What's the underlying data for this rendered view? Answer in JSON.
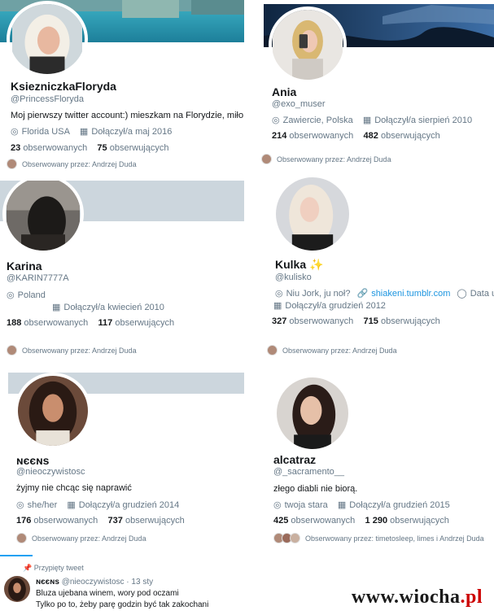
{
  "profiles": [
    {
      "name": "KsiezniczkaFloryda",
      "handle": "@PrincessFloryda",
      "bio": "Moj pierwszy twitter account:) mieszkam na Florydzie, miło mi p",
      "location": "Florida USA",
      "joined": "Dołączył/a maj 2016",
      "following_count": "23",
      "following_label": "obserwowanych",
      "followers_count": "75",
      "followers_label": "obserwujących",
      "followed_by": "Obserwowany przez: Andrzej Duda"
    },
    {
      "name": "Ania",
      "handle": "@exo_muser",
      "location": "Zawiercie, Polska",
      "joined": "Dołączył/a sierpień 2010",
      "following_count": "214",
      "following_label": "obserwowanych",
      "followers_count": "482",
      "followers_label": "obserwujących",
      "followed_by": "Obserwowany przez: Andrzej Duda"
    },
    {
      "name": "Karina",
      "handle": "@KARIN7777A",
      "location": "Poland",
      "joined": "Dołączył/a kwiecień 2010",
      "following_count": "188",
      "following_label": "obserwowanych",
      "followers_count": "117",
      "followers_label": "obserwujących",
      "followed_by": "Obserwowany przez: Andrzej Duda"
    },
    {
      "name": "Kulka",
      "name_emoji": "✨",
      "handle": "@kulisko",
      "location": "Niu Jork, ju noł?",
      "website": "shiakeni.tumblr.com",
      "birthday": "Data ur",
      "joined": "Dołączył/a grudzień 2012",
      "following_count": "327",
      "following_label": "obserwowanych",
      "followers_count": "715",
      "followers_label": "obserwujących",
      "followed_by": "Obserwowany przez: Andrzej Duda"
    },
    {
      "name": "ɴєєɴѕ",
      "handle": "@nieoczywistosc",
      "bio": "żyjmy nie chcąc się naprawić",
      "location": "she/her",
      "joined": "Dołączył/a grudzień 2014",
      "following_count": "176",
      "following_label": "obserwowanych",
      "followers_count": "737",
      "followers_label": "obserwujących",
      "followed_by": "Obserwowany przez: Andrzej Duda"
    },
    {
      "name": "alcatraz",
      "handle": "@_sacramento__",
      "bio": "złego diabli nie biorą.",
      "location": "twoja stara",
      "joined": "Dołączył/a grudzień 2015",
      "following_count": "425",
      "following_label": "obserwowanych",
      "followers_count": "1 290",
      "followers_label": "obserwujących",
      "followed_by": "Obserwowany przez: timetosleep, limes i Andrzej Duda"
    }
  ],
  "pinned_tweet": {
    "label": "Przypięty tweet",
    "author": "ɴєєɴѕ",
    "handle_time": "@nieoczywistosc · 13 sty",
    "line1": "Bluza ujebana winem, wory pod oczami",
    "line2": "Tylko po to, żeby parę godzin być tak zakochani"
  },
  "watermark": {
    "prefix": "www.",
    "main": "wiocha",
    "suffix": ".pl"
  },
  "colors": {
    "link": "#1b95e0",
    "secondary": "#657786",
    "banner_placeholder": "#ccd6dd"
  }
}
